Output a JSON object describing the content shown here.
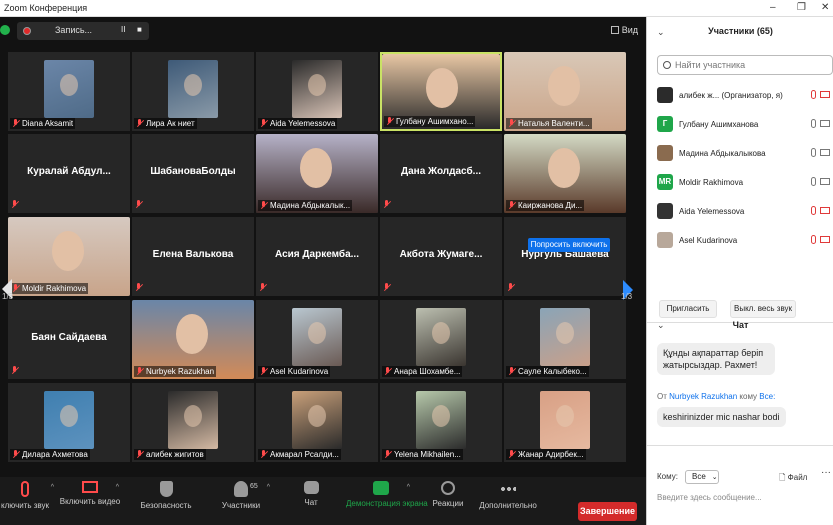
{
  "window": {
    "title": "Zoom Конференция"
  },
  "recording": {
    "label": "Запись...",
    "pause": "II",
    "stop": "■"
  },
  "view": {
    "label": "Вид"
  },
  "ask_unmute": "Попросить включить",
  "page": {
    "left": "1/3",
    "right": "1/3"
  },
  "tiles": [
    {
      "label": "Diana Aksamit",
      "type": "photo"
    },
    {
      "label": "Лира Ак ниет",
      "type": "photo"
    },
    {
      "label": "Aida Yelemessova",
      "type": "photo"
    },
    {
      "label": "Гулбану Ашимхано...",
      "type": "video",
      "active": true
    },
    {
      "label": "Наталья Валенти...",
      "type": "video"
    },
    {
      "name": "Куралай  Абдул...",
      "type": "name"
    },
    {
      "name": "ШабановаБолды",
      "type": "name"
    },
    {
      "label": "Мадина Абдыкалык...",
      "type": "video"
    },
    {
      "name": "Дана  Жолдасб...",
      "type": "name"
    },
    {
      "label": "Каиржанова Ди...",
      "type": "video"
    },
    {
      "label": "Moldir Rakhimova",
      "type": "video"
    },
    {
      "name": "Елена Валькова",
      "type": "name"
    },
    {
      "name": "Асия  Даркемба...",
      "type": "name"
    },
    {
      "name": "Акбота  Жумаге...",
      "type": "name"
    },
    {
      "name": "Нургуль  Башаева",
      "type": "name"
    },
    {
      "name": "Баян  Сайдаева",
      "type": "name"
    },
    {
      "label": "Nurbyek Razukhan",
      "type": "video"
    },
    {
      "label": "Asel Kudarinova",
      "type": "photo"
    },
    {
      "label": "Анара Шохамбе...",
      "type": "photo"
    },
    {
      "label": "Сауле Калыбеко...",
      "type": "photo"
    },
    {
      "label": "Дилара Ахметова",
      "type": "photo"
    },
    {
      "label": "алибек жигитов",
      "type": "photo"
    },
    {
      "label": "Акмарал Рсалди...",
      "type": "photo"
    },
    {
      "label": "Yelena Mikhailen...",
      "type": "photo"
    },
    {
      "label": "Жанар Адирбек...",
      "type": "photo"
    }
  ],
  "toolbar": [
    {
      "label": "ключить звук",
      "icon": "mic-muted-icon",
      "caret": "^"
    },
    {
      "label": "Включить видео",
      "icon": "video-off-icon",
      "caret": "^"
    },
    {
      "label": "Безопасность",
      "icon": "shield-icon"
    },
    {
      "label": "Участники",
      "icon": "participants-icon",
      "count": "65",
      "caret": "^"
    },
    {
      "label": "Чат",
      "icon": "chat-icon"
    },
    {
      "label": "Демонстрация экрана",
      "icon": "share-screen-icon",
      "caret": "^"
    },
    {
      "label": "Реакции",
      "icon": "reactions-icon"
    },
    {
      "label": "Дополнительно",
      "icon": "more-icon"
    }
  ],
  "end_button": "Завершение",
  "participants": {
    "title": "Участники (65)",
    "search_placeholder": "Найти участника",
    "list": [
      {
        "name": "алибек ж...  (Организатор, я)",
        "avatar": "",
        "avatar_color": "#2b2b2b",
        "mic": "off",
        "cam": "off"
      },
      {
        "name": "Гулбану Ашимханова",
        "avatar": "Г",
        "avatar_color": "#1fa64a",
        "mic": "on",
        "cam": "on"
      },
      {
        "name": "Мадина Абдыкалыкова",
        "avatar": "",
        "avatar_color": "#8a6b4f",
        "mic": "on",
        "cam": "on"
      },
      {
        "name": "Moldir Rakhimova",
        "avatar": "MR",
        "avatar_color": "#1fa64a",
        "mic": "on",
        "cam": "on"
      },
      {
        "name": "Aida Yelemessova",
        "avatar": "",
        "avatar_color": "#333333",
        "mic": "off",
        "cam": "off"
      },
      {
        "name": "Asel Kudarinova",
        "avatar": "",
        "avatar_color": "#b8a89a",
        "mic": "off",
        "cam": "off"
      }
    ],
    "invite": "Пригласить",
    "mute_all": "Выкл. весь звук"
  },
  "chat": {
    "title": "Чат",
    "messages": [
      {
        "text": "Құнды ақпараттар беріп жатырсыздар.  Рахмет!"
      },
      {
        "from_prefix": "От",
        "from": "Nurbyek Razukhan",
        "mid": "кому",
        "to": "Все:",
        "text": "keshirinizder mic nashar bodi"
      }
    ],
    "to_label": "Кому:",
    "to_value": "Все",
    "file_label": "Файл",
    "more": "···",
    "input_placeholder": "Введите здесь сообщение..."
  }
}
